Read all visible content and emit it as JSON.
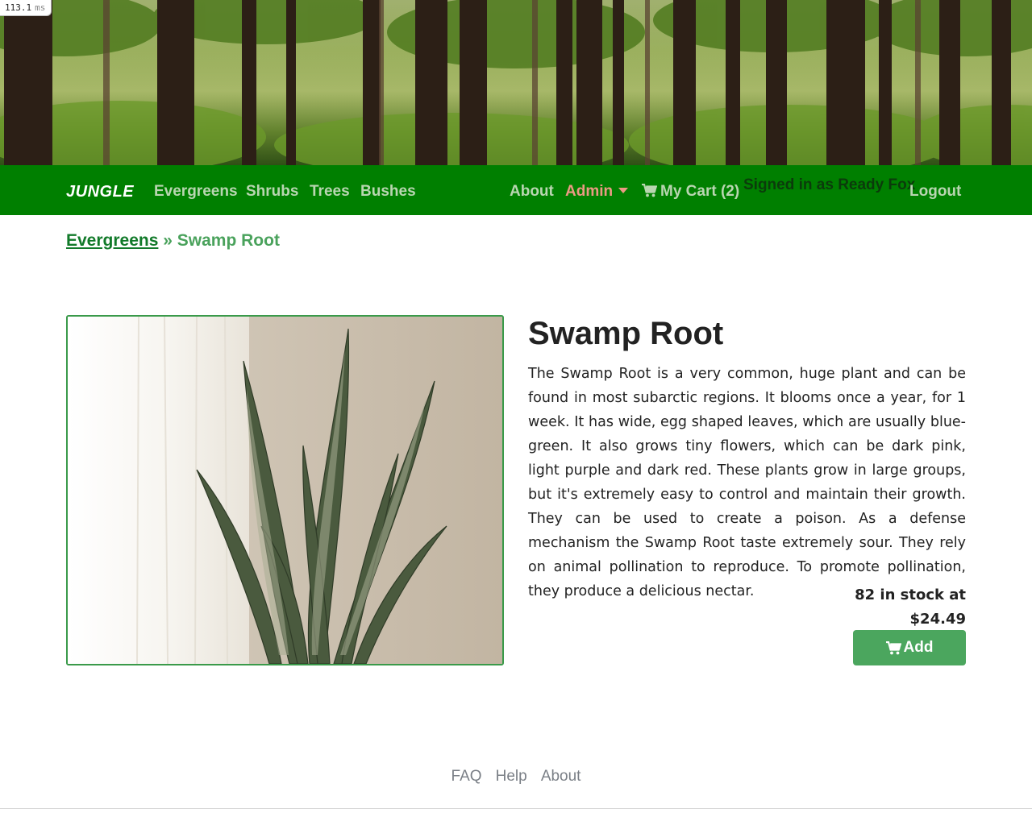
{
  "timing": {
    "value": "113.1",
    "unit": "ms"
  },
  "nav": {
    "brand": "JUNGLE",
    "left_links": [
      "Evergreens",
      "Shrubs",
      "Trees",
      "Bushes"
    ],
    "about": "About",
    "admin": "Admin",
    "cart": "My Cart (2)",
    "signed_in": "Signed in as Ready Fox",
    "logout": "Logout"
  },
  "breadcrumb": {
    "category": "Evergreens",
    "separator": "»",
    "current": "Swamp Root"
  },
  "product": {
    "title": "Swamp Root",
    "description": "The Swamp Root is a very common, huge plant and can be found in most subarctic regions. It blooms once a year, for 1 week. It has wide, egg shaped leaves, which are usually blue-green. It also grows tiny flowers, which can be dark pink, light purple and dark red. These plants grow in large groups, but it's extremely easy to control and maintain their growth. They can be used to create a poison. As a defense mechanism the Swamp Root taste extremely sour. They rely on animal pollination to reproduce. To promote pollination, they produce a delicious nectar.",
    "stock_line": "82 in stock at",
    "price": "$24.49",
    "add_label": "Add"
  },
  "footer": {
    "links": [
      "FAQ",
      "Help",
      "About"
    ]
  },
  "colors": {
    "navbar": "#007f00",
    "admin": "#ec9a84",
    "accent_button": "#4ba65e",
    "breadcrumb_link": "#127a2a"
  }
}
